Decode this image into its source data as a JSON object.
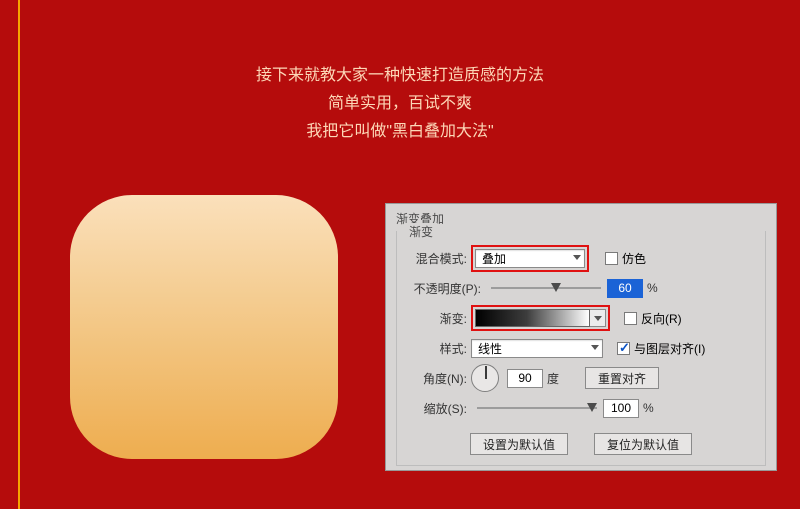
{
  "intro": {
    "line1": "接下来就教大家一种快速打造质感的方法",
    "line2": "简单实用，百试不爽",
    "line3": "我把它叫做\"黑白叠加大法\""
  },
  "panel": {
    "title": "渐变叠加",
    "group_legend": "渐变",
    "rows": {
      "blend_label": "混合模式:",
      "blend_value": "叠加",
      "dither_label": "仿色",
      "opacity_label": "不透明度(P):",
      "opacity_value": "60",
      "opacity_unit": "%",
      "gradient_label": "渐变:",
      "reverse_label": "反向(R)",
      "style_label": "样式:",
      "style_value": "线性",
      "align_label": "与图层对齐(I)",
      "angle_label": "角度(N):",
      "angle_value": "90",
      "angle_unit": "度",
      "reset_align_btn": "重置对齐",
      "scale_label": "缩放(S):",
      "scale_value": "100",
      "scale_unit": "%"
    },
    "footer": {
      "set_default": "设置为默认值",
      "reset_default": "复位为默认值"
    }
  },
  "colors": {
    "bg": "#b50c0c",
    "accent": "#f7a400",
    "highlight": "#e01111"
  }
}
